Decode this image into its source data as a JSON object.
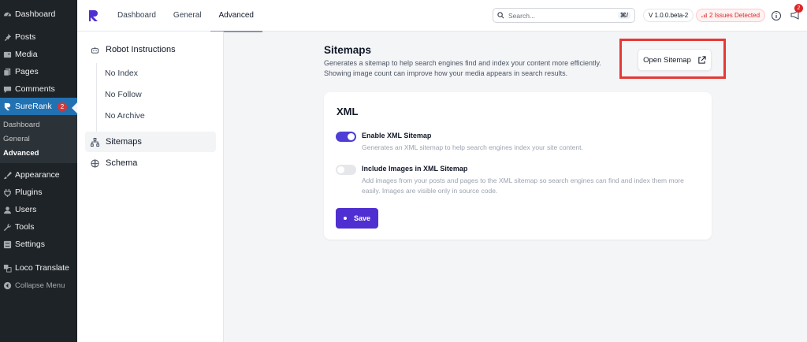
{
  "wp_menu": {
    "items_top": [
      {
        "label": "Dashboard",
        "icon": "dashboard-icon"
      },
      {
        "label": "Posts",
        "icon": "pin-icon"
      },
      {
        "label": "Media",
        "icon": "media-icon"
      },
      {
        "label": "Pages",
        "icon": "pages-icon"
      },
      {
        "label": "Comments",
        "icon": "comments-icon"
      }
    ],
    "surerank": {
      "label": "SureRank",
      "badge": "2"
    },
    "submenu": [
      "Dashboard",
      "General",
      "Advanced"
    ],
    "items_bottom": [
      {
        "label": "Appearance",
        "icon": "brush-icon"
      },
      {
        "label": "Plugins",
        "icon": "plug-icon"
      },
      {
        "label": "Users",
        "icon": "user-icon"
      },
      {
        "label": "Tools",
        "icon": "wrench-icon"
      },
      {
        "label": "Settings",
        "icon": "settings-icon"
      }
    ],
    "loco": "Loco Translate",
    "collapse": "Collapse Menu"
  },
  "topbar": {
    "tabs": [
      "Dashboard",
      "General",
      "Advanced"
    ],
    "active_tab": "Advanced",
    "search_placeholder": "Search...",
    "search_shortcut": "⌘/",
    "version": "V 1.0.0.beta-2",
    "issues": "2 Issues Detected",
    "notification_count": "2"
  },
  "settings_nav": {
    "robot_instructions": "Robot Instructions",
    "children": [
      "No Index",
      "No Follow",
      "No Archive"
    ],
    "sitemaps": "Sitemaps",
    "schema": "Schema"
  },
  "main": {
    "title": "Sitemaps",
    "description": "Generates a sitemap to help search engines find and index your content more efficiently. Showing image count can improve how your media appears in search results.",
    "open_sitemap": "Open Sitemap"
  },
  "xml_card": {
    "title": "XML",
    "options": [
      {
        "label": "Enable XML Sitemap",
        "description": "Generates an XML sitemap to help search engines index your site content.",
        "enabled": true
      },
      {
        "label": "Include Images in XML Sitemap",
        "description": "Add images from your posts and pages to the XML sitemap so search engines can find and index them more easily. Images are visible only in source code.",
        "enabled": false
      }
    ],
    "save": "Save"
  },
  "colors": {
    "accent": "#4f2fd1",
    "wp_sidebar": "#1d2327",
    "wp_active": "#2271b1",
    "highlight": "#e53935",
    "issues": "#dc2626"
  }
}
